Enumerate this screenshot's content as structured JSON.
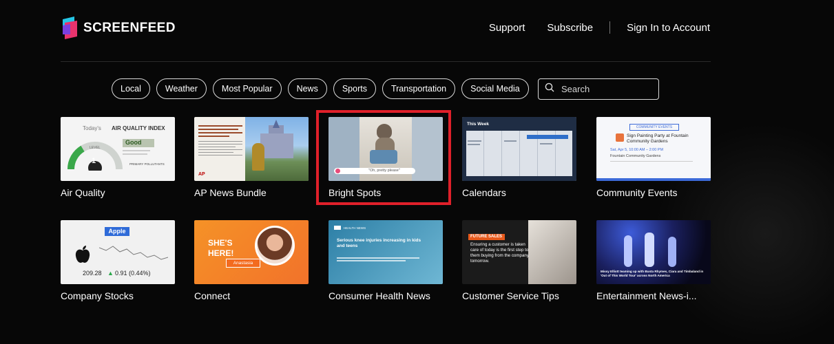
{
  "brand": {
    "name": "SCREENFEED"
  },
  "nav": {
    "support": "Support",
    "subscribe": "Subscribe",
    "sign_in": "Sign In to Account"
  },
  "filters": [
    "Local",
    "Weather",
    "Most Popular",
    "News",
    "Sports",
    "Transportation",
    "Social Media"
  ],
  "search": {
    "placeholder": "Search"
  },
  "tiles": [
    {
      "label": "Air Quality"
    },
    {
      "label": "AP News Bundle"
    },
    {
      "label": "Bright Spots"
    },
    {
      "label": "Calendars"
    },
    {
      "label": "Community Events"
    },
    {
      "label": "Company Stocks"
    },
    {
      "label": "Connect"
    },
    {
      "label": "Consumer Health News"
    },
    {
      "label": "Customer Service Tips"
    },
    {
      "label": "Entertainment News-i..."
    }
  ],
  "thumbs": {
    "air_quality": {
      "heading": "Today's",
      "index": "AIR QUALITY INDEX",
      "status": "Good",
      "level_label": "LEVEL",
      "level": "1",
      "pollutants": "PRIMARY POLLUTANTS"
    },
    "ap_news": {
      "badge": "AP"
    },
    "bright_spots": {
      "caption": "\"Oh, pretty please\""
    },
    "calendars": {
      "title": "This Week"
    },
    "community_events": {
      "tag": "COMMUNITY EVENTS",
      "title": "Sign Painting Party at Fountain Community Gardens",
      "date": "Sat, Apr 5, 10:00 AM – 2:00 PM",
      "place": "Fountain Community Gardens"
    },
    "company_stocks": {
      "company": "Apple",
      "price": "209.28",
      "change": "0.91 (0.44%)"
    },
    "connect": {
      "headline_1": "SHE'S",
      "headline_2": "HERE!",
      "name": "Anastasia"
    },
    "consumer_health": {
      "tag": "HEALTH NEWS",
      "headline": "Serious knee injuries increasing in kids and teens"
    },
    "customer_service": {
      "tag": "FUTURE SALES",
      "tip": "Ensuring a customer is taken care of today is the first step to them buying from the company tomorrow."
    },
    "entertainment": {
      "caption": "Missy Elliott teaming up with Busta Rhymes, Ciara and Timbaland in 'Out of This World Tour' across North America"
    }
  },
  "colors": {
    "accent_highlight": "#e0202a",
    "background": "#070707",
    "stock_up": "#2aa84a"
  }
}
